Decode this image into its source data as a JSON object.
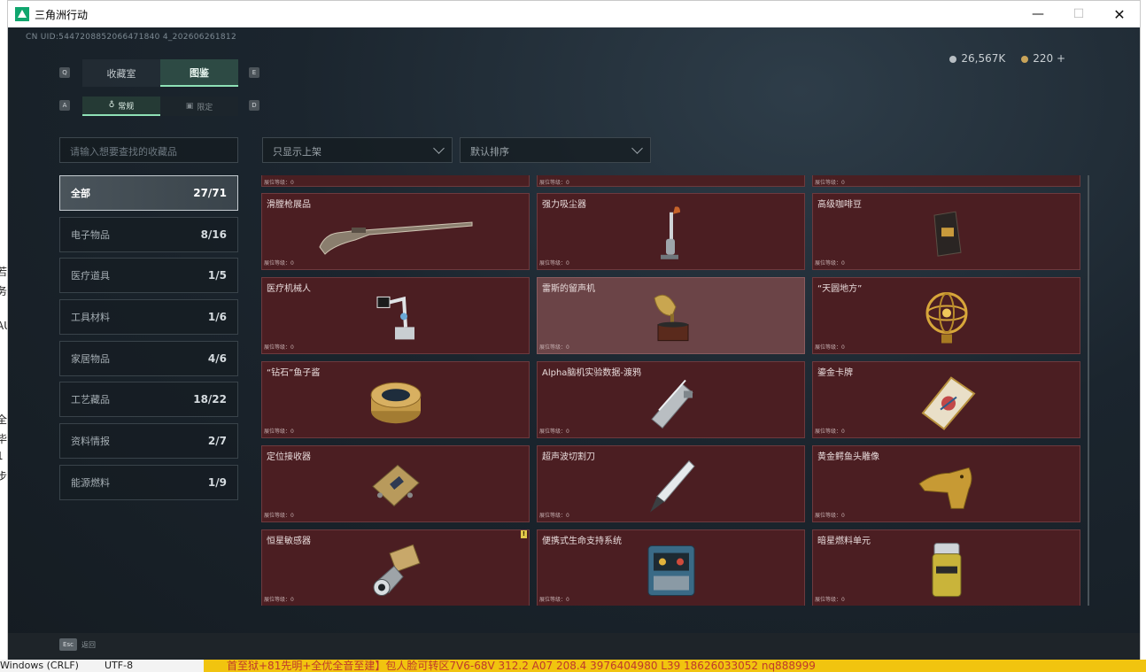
{
  "window": {
    "title": "三角洲行动",
    "minimize": "—",
    "maximize": "☐",
    "close": "✕"
  },
  "header": {
    "uid": "CN UID:5447208852066471840 4_202606261812",
    "silver": "26,567K",
    "gold": "220 +"
  },
  "tabs": {
    "q_key": "Q",
    "e_key": "E",
    "items": [
      "收藏室",
      "图鉴"
    ],
    "active": 1,
    "a_key": "A",
    "d_key": "D",
    "sub": [
      "常规",
      "限定"
    ]
  },
  "search": {
    "placeholder": "请输入想要查找的收藏品"
  },
  "filters": {
    "shelf": "只显示上架",
    "sort": "默认排序"
  },
  "categories": [
    {
      "label": "全部",
      "count": "27/71"
    },
    {
      "label": "电子物品",
      "count": "8/16"
    },
    {
      "label": "医疗道具",
      "count": "1/5"
    },
    {
      "label": "工具材料",
      "count": "1/6"
    },
    {
      "label": "家居物品",
      "count": "4/6"
    },
    {
      "label": "工艺藏品",
      "count": "18/22"
    },
    {
      "label": "资料情报",
      "count": "2/7"
    },
    {
      "label": "能源燃料",
      "count": "1/9"
    }
  ],
  "grid": {
    "level_label": "展位等级：0",
    "cards": [
      {
        "name": "滑膛枪展品",
        "icon": "musket-icon"
      },
      {
        "name": "强力吸尘器",
        "icon": "vacuum-icon"
      },
      {
        "name": "高级咖啡豆",
        "icon": "coffee-bag-icon"
      },
      {
        "name": "医疗机械人",
        "icon": "medical-robot-icon"
      },
      {
        "name": "雷斯的留声机",
        "icon": "gramophone-icon"
      },
      {
        "name": "“天圆地方”",
        "icon": "armillary-icon"
      },
      {
        "name": "“钻石”鱼子酱",
        "icon": "caviar-tin-icon"
      },
      {
        "name": "Alpha脑机实验数据-渡鸦",
        "icon": "data-canister-icon"
      },
      {
        "name": "鎏金卡牌",
        "icon": "gilded-card-icon"
      },
      {
        "name": "定位接收器",
        "icon": "receiver-icon"
      },
      {
        "name": "超声波切割刀",
        "icon": "ultrasonic-knife-icon"
      },
      {
        "name": "黄金鳄鱼头雕像",
        "icon": "gold-croc-icon"
      },
      {
        "name": "恒星敏感器",
        "icon": "star-sensor-icon"
      },
      {
        "name": "便携式生命支持系统",
        "icon": "life-support-icon"
      },
      {
        "name": "暗星燃料单元",
        "icon": "fuel-cell-icon"
      }
    ],
    "new_badge": "!"
  },
  "footer": {
    "esc_key": "Esc",
    "esc_label": "返回"
  },
  "desktop": {
    "taskbar_left": "Windows (CRLF)",
    "taskbar_enc": "UTF-8",
    "taskbar_yellow": "首至狱+81先明+全优全音至建】包人脸可转区7V6-68V 312.2    A07          208.4        3976404980   L39            18626033052   nq888999",
    "side_chars": [
      "若",
      "务",
      "AU",
      "全",
      "毕",
      "1",
      "步"
    ]
  },
  "colors": {
    "card_bg": "#4b1e22",
    "accent": "#8fe1b6"
  }
}
